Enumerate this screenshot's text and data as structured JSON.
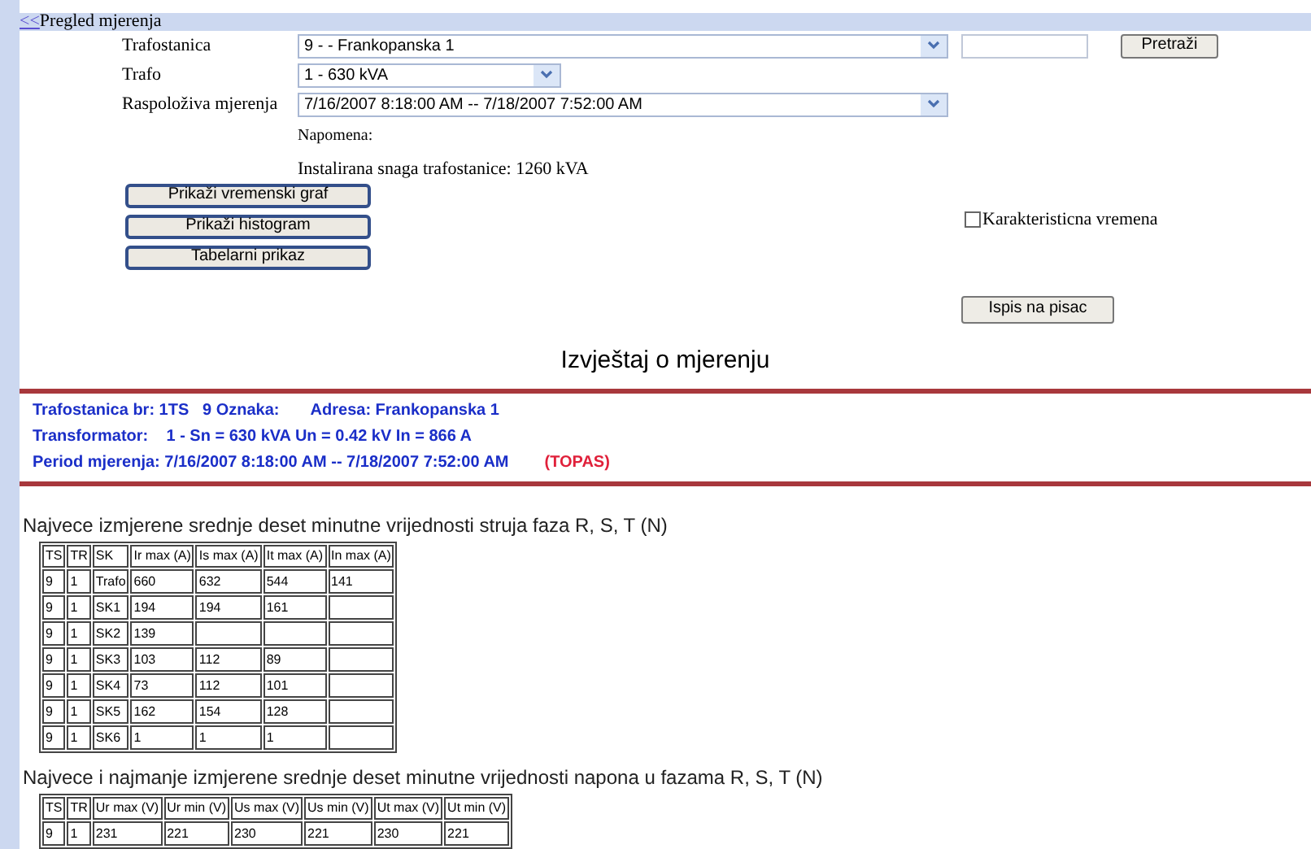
{
  "header": {
    "back_link": "<<",
    "title": "Pregled mjerenja"
  },
  "form": {
    "fields": [
      {
        "label": "Trafostanica",
        "value": "9 - - Frankopanska 1",
        "kind": "wide"
      },
      {
        "label": "Trafo",
        "value": "1 - 630 kVA",
        "kind": "narrow"
      },
      {
        "label": "Raspoloživa mjerenja",
        "value": "7/16/2007 8:18:00 AM -- 7/18/2007 7:52:00 AM",
        "kind": "wide"
      }
    ],
    "search_button": "Pretraži",
    "note": "Napomena:",
    "installed": "Instalirana snaga trafostanice: 1260 kVA",
    "buttons": [
      "Prikaži vremenski graf",
      "Prikaži histogram",
      "Tabelarni prikaz"
    ],
    "checkbox": {
      "label": "Karakteristicna vremena",
      "checked": false
    },
    "print_button": "Ispis na pisac"
  },
  "report": {
    "title": "Izvještaj o mjerenju",
    "info_lines": [
      {
        "text": "Trafostanica br: 1TS   9 Oznaka:       Adresa: Frankopanska 1"
      },
      {
        "text": "Transformator:    1 - Sn = 630 kVA Un = 0.42 kV In = 866 A"
      },
      {
        "text": "Period mjerenja: 7/16/2007 8:18:00 AM -- 7/18/2007 7:52:00 AM",
        "tag": "(TOPAS)"
      }
    ]
  },
  "tables": [
    {
      "heading": "Najvece izmjerene srednje deset minutne vrijednosti struja faza R, S, T (N)",
      "columns": [
        "TS",
        "TR",
        "SK",
        "Ir max (A)",
        "Is max (A)",
        "It max (A)",
        "In max (A)"
      ],
      "rows": [
        [
          "9",
          "1",
          "Trafo",
          "660",
          "632",
          "544",
          "141"
        ],
        [
          "9",
          "1",
          "SK1",
          "194",
          "194",
          "161",
          ""
        ],
        [
          "9",
          "1",
          "SK2",
          "139",
          "",
          "",
          ""
        ],
        [
          "9",
          "1",
          "SK3",
          "103",
          "112",
          "89",
          ""
        ],
        [
          "9",
          "1",
          "SK4",
          "73",
          "112",
          "101",
          ""
        ],
        [
          "9",
          "1",
          "SK5",
          "162",
          "154",
          "128",
          ""
        ],
        [
          "9",
          "1",
          "SK6",
          "1",
          "1",
          "1",
          ""
        ]
      ]
    },
    {
      "heading": "Najvece i najmanje izmjerene srednje deset minutne vrijednosti napona u fazama R, S, T (N)",
      "columns": [
        "TS",
        "TR",
        "Ur max (V)",
        "Ur min (V)",
        "Us max (V)",
        "Us min (V)",
        "Ut max (V)",
        "Ut min (V)"
      ],
      "rows": [
        [
          "9",
          "1",
          "231",
          "221",
          "230",
          "221",
          "230",
          "221"
        ]
      ]
    }
  ]
}
